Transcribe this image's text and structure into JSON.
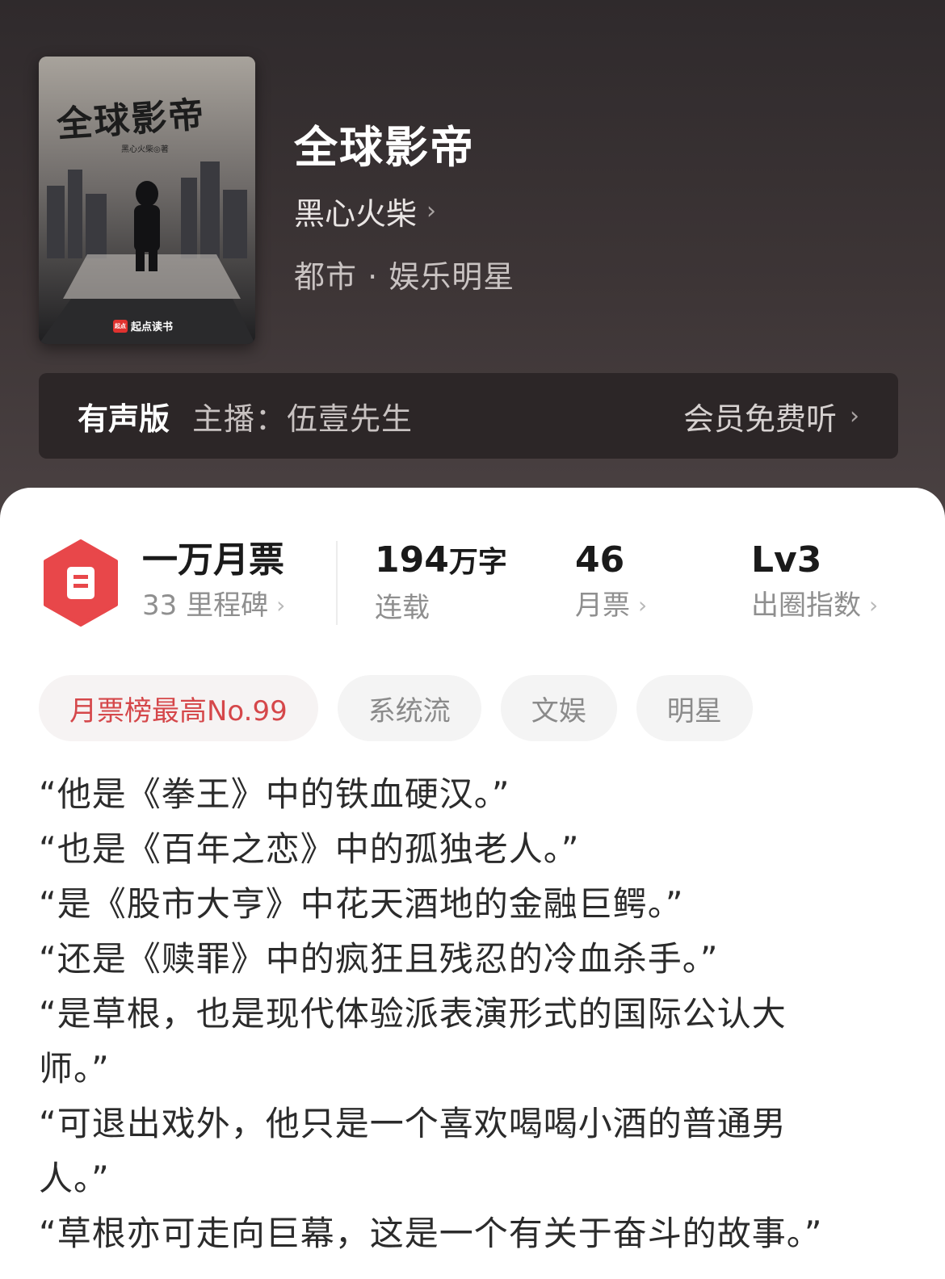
{
  "book": {
    "title": "全球影帝",
    "author": "黑心火柴",
    "category": "都市 · 娱乐明星",
    "cover": {
      "title": "全球影帝",
      "author_line": "黑心火柴◎著",
      "publisher": "起点读书",
      "publisher_mark": "起点"
    }
  },
  "audio": {
    "tag": "有声版",
    "host": "主播：伍壹先生",
    "cta": "会员免费听"
  },
  "stats": [
    {
      "value": "一万月票",
      "label": "33 里程碑"
    },
    {
      "value": "194",
      "unit": "万字",
      "label": "连载"
    },
    {
      "value": "46",
      "label": "月票"
    },
    {
      "value": "Lv3",
      "label": "出圈指数"
    }
  ],
  "tags": [
    "月票榜最高No.99",
    "系统流",
    "文娱",
    "明星"
  ],
  "synopsis": [
    "“他是《拳王》中的铁血硬汉。”",
    "“也是《百年之恋》中的孤独老人。”",
    "“是《股市大亨》中花天酒地的金融巨鳄。”",
    "“还是《赎罪》中的疯狂且残忍的冷血杀手。”",
    "“是草根，也是现代体验派表演形式的国际公认大",
    "师。”",
    "“可退出戏外，他只是一个喜欢喝喝小酒的普通男",
    "人。”",
    "“草根亦可走向巨幕，这是一个有关于奋斗的故事。”"
  ],
  "colors": {
    "accent_red": "#e0322f",
    "hero_bg": "#3a3334"
  },
  "icons": {
    "chevron": "›",
    "badge": "ticket-badge-icon"
  }
}
